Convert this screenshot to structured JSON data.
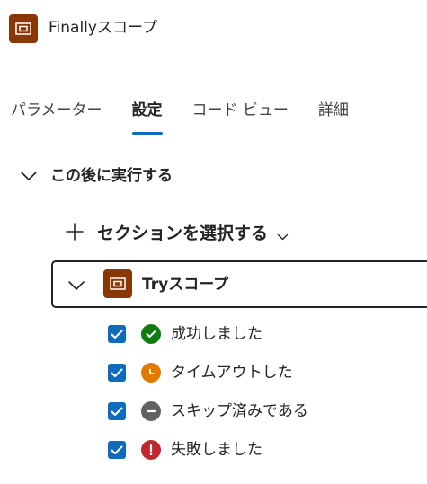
{
  "header": {
    "title": "Finallyスコープ",
    "icon": "scope-icon",
    "icon_color": "#8a3707"
  },
  "tabs": [
    {
      "label": "パラメーター",
      "active": false
    },
    {
      "label": "設定",
      "active": true
    },
    {
      "label": "コード ビュー",
      "active": false
    },
    {
      "label": "詳細",
      "active": false
    }
  ],
  "run_after": {
    "section_label": "この後に実行する",
    "expanded": true,
    "select_label": "セクションを選択する",
    "action": {
      "label": "Tryスコープ",
      "icon": "scope-icon",
      "expanded": true
    },
    "statuses": [
      {
        "label": "成功しました",
        "checked": true,
        "icon": "check-circle-icon",
        "color": "#107c10"
      },
      {
        "label": "タイムアウトした",
        "checked": true,
        "icon": "clock-icon",
        "color": "#e07a00"
      },
      {
        "label": "スキップ済みである",
        "checked": true,
        "icon": "minus-circle-icon",
        "color": "#616161"
      },
      {
        "label": "失敗しました",
        "checked": true,
        "icon": "error-circle-icon",
        "color": "#c4262e"
      }
    ]
  },
  "colors": {
    "accent": "#0f6cbd",
    "text": "#242424"
  }
}
